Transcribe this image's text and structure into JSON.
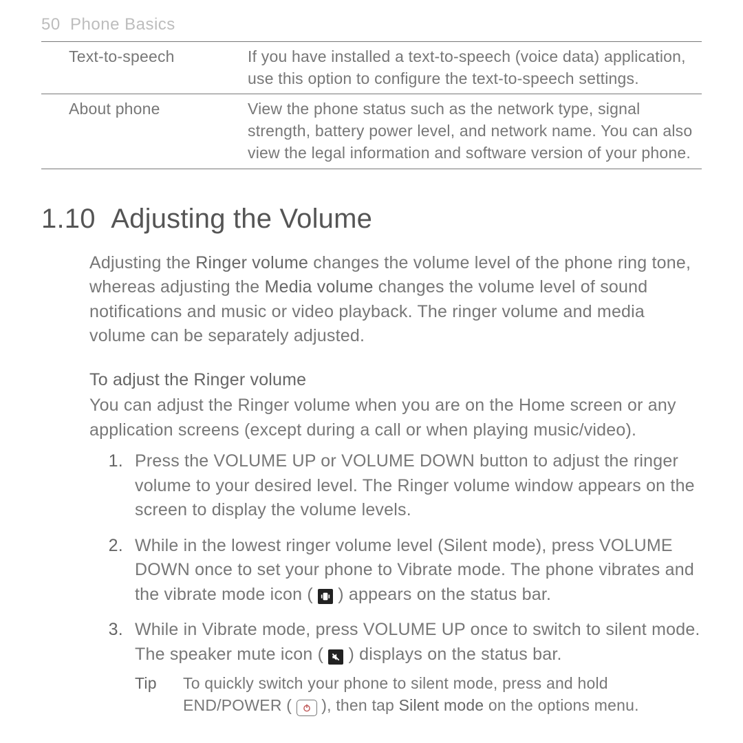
{
  "running_head": {
    "page": "50",
    "chapter": "Phone Basics"
  },
  "table": {
    "rows": [
      {
        "term": "Text-to-speech",
        "desc": "If you have installed a text-to-speech (voice data) application, use this option to configure the text-to-speech settings."
      },
      {
        "term": "About phone",
        "desc": "View the phone status such as the network type, signal strength, battery power level, and network name. You can also view the legal information and software version of your phone."
      }
    ]
  },
  "section": {
    "number": "1.10",
    "title": "Adjusting the Volume"
  },
  "intro": {
    "seg1": "Adjusting the ",
    "strong1": "Ringer volume",
    "seg2": " changes the volume level of the phone ring tone, whereas adjusting the ",
    "strong2": "Media volume",
    "seg3": " changes the volume level of sound notifications and music or video playback. The ringer volume and media volume can be separately adjusted."
  },
  "sub1": {
    "heading": "To adjust the Ringer volume",
    "para": "You can adjust the Ringer volume when you are on the Home screen or any application screens (except during a call or when playing music/video)."
  },
  "steps": {
    "item1": "Press the VOLUME UP or VOLUME DOWN button to adjust the ringer volume to your desired level. The Ringer volume window appears on the screen to display the volume levels.",
    "item2": {
      "a": "While in the lowest ringer volume level (Silent mode), press VOLUME DOWN once to set your phone to Vibrate mode. The phone vibrates and the vibrate mode icon ( ",
      "b": " ) appears on the status bar."
    },
    "item3": {
      "a": "While in Vibrate mode, press VOLUME UP once to switch to silent mode. The speaker mute icon ( ",
      "b": " ) displays on the status bar."
    }
  },
  "tip": {
    "label": "Tip",
    "a": "To quickly switch your phone to silent mode, press and hold END/POWER ( ",
    "b": " ), then tap ",
    "strong": "Silent mode",
    "c": " on the options menu."
  }
}
